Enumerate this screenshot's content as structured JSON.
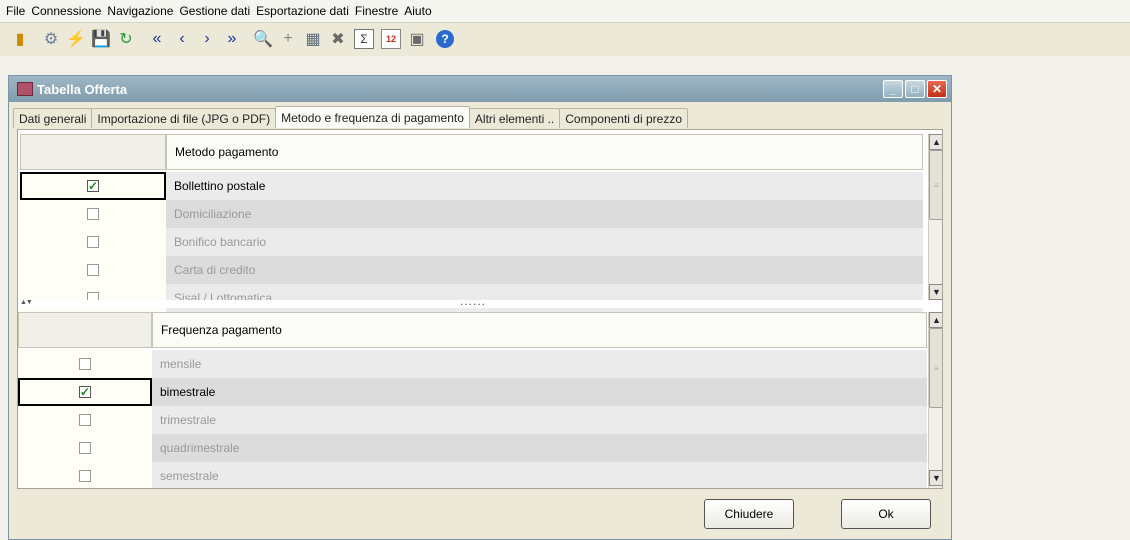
{
  "menu": [
    "File",
    "Connessione",
    "Navigazione",
    "Gestione dati",
    "Esportazione dati",
    "Finestre",
    "Aiuto"
  ],
  "toolbar": {
    "icons": [
      "exit-icon",
      "tools-icon",
      "import-icon",
      "save-icon",
      "refresh-icon",
      "first-record-icon",
      "previous-record-icon",
      "next-record-icon",
      "last-record-icon",
      "search-icon",
      "add-icon",
      "grid-icon",
      "delete-icon",
      "sum-icon",
      "calendar-icon",
      "image-icon",
      "help-icon"
    ],
    "glyphs": [
      "▮",
      "⚙",
      "⚡",
      "💾",
      "↻",
      "«",
      "‹",
      "›",
      "»",
      "🔍",
      "+",
      "▦",
      "✖",
      "Σ",
      "12",
      "▣",
      "?"
    ],
    "colors": [
      "#d08a00",
      "#6a7f9a",
      "#d89a20",
      "#1a3a8a",
      "#2a9a3a",
      "#1a3a9a",
      "#1a3a9a",
      "#1a3a9a",
      "#1a3a9a",
      "#6a7a8a",
      "#8a8a8a",
      "#5a6a7a",
      "#6a6a6a",
      "#333333",
      "#c03020",
      "#6a6a6a",
      "#2a6ad0"
    ]
  },
  "window": {
    "title": "Tabella Offerta",
    "controls": [
      "_",
      "□",
      "✕"
    ]
  },
  "tabs": [
    {
      "label": "Dati generali",
      "active": false
    },
    {
      "label": "Importazione di file (JPG o PDF)",
      "active": false
    },
    {
      "label": "Metodo e frequenza di pagamento",
      "active": true
    },
    {
      "label": "Altri elementi ..",
      "active": false
    },
    {
      "label": "Componenti di prezzo",
      "active": false
    }
  ],
  "metodo": {
    "header": "Metodo pagamento",
    "rows": [
      {
        "label": "Bollettino postale",
        "checked": true
      },
      {
        "label": "Domiciliazione",
        "checked": false
      },
      {
        "label": "Bonifico bancario",
        "checked": false
      },
      {
        "label": "Carta di credito",
        "checked": false
      },
      {
        "label": "Sisal / Lottomatica",
        "checked": false
      }
    ]
  },
  "frequenza": {
    "header": "Frequenza pagamento",
    "rows": [
      {
        "label": "mensile",
        "checked": false
      },
      {
        "label": "bimestrale",
        "checked": true
      },
      {
        "label": "trimestrale",
        "checked": false
      },
      {
        "label": "quadrimestrale",
        "checked": false
      },
      {
        "label": "semestrale",
        "checked": false
      }
    ]
  },
  "splitter": {
    "dots": "......",
    "arrows": "▲▼"
  },
  "scroll": {
    "up": "▲",
    "down": "▼",
    "grip": "≡"
  },
  "buttons": {
    "close": "Chiudere",
    "ok": "Ok"
  }
}
